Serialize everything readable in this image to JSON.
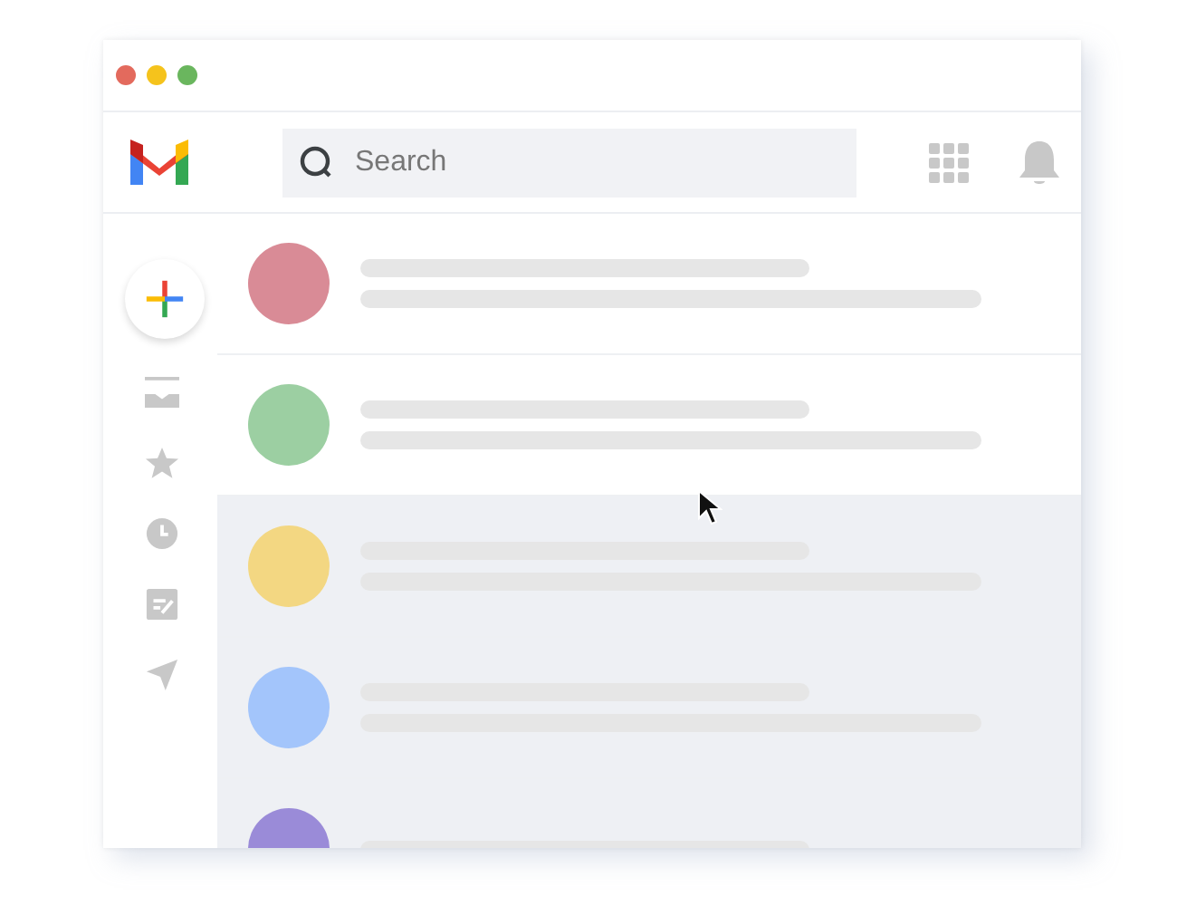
{
  "search": {
    "placeholder": "Search"
  },
  "emails": [
    {
      "color": "#d98b96",
      "read": false
    },
    {
      "color": "#9ccfa2",
      "read": false
    },
    {
      "color": "#f3d782",
      "read": true
    },
    {
      "color": "#a3c5fb",
      "read": true
    },
    {
      "color": "#9a8bd8",
      "read": true
    }
  ]
}
